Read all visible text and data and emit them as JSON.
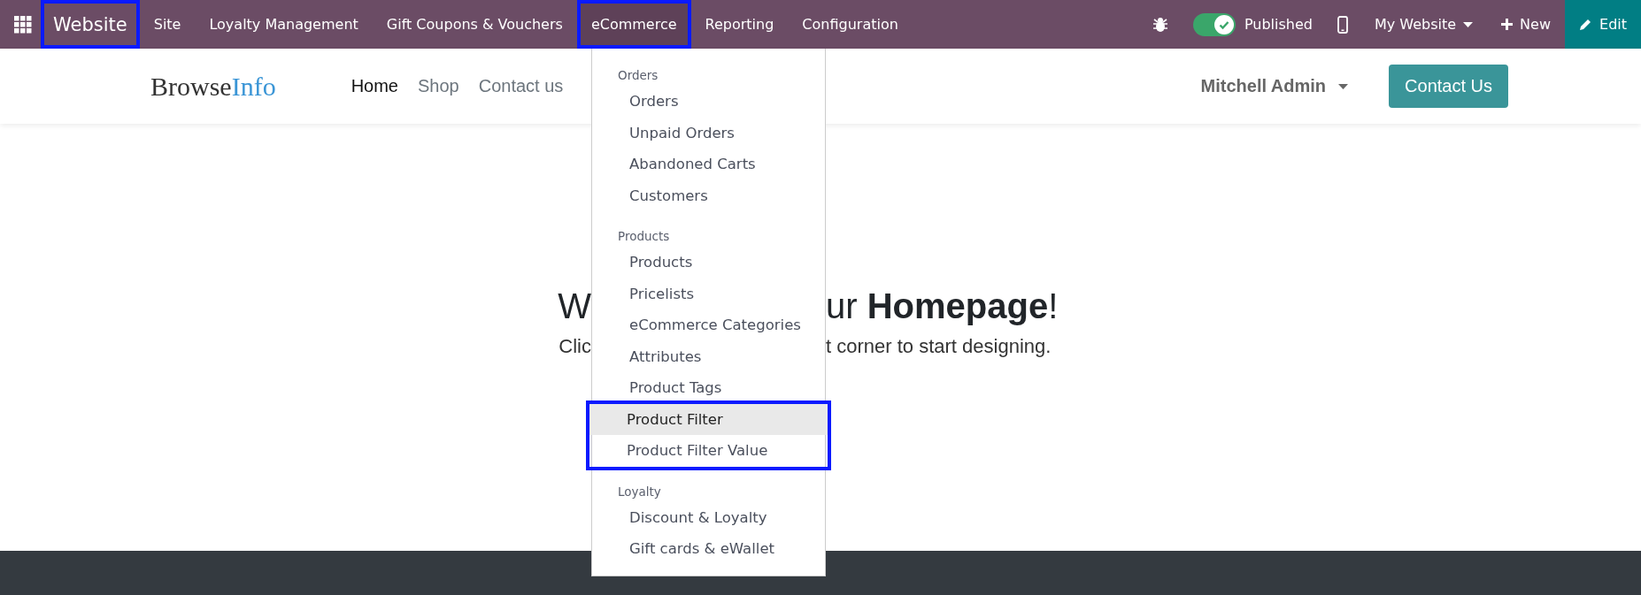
{
  "top_bar": {
    "app_name": {
      "label": "Website",
      "outlined": true
    },
    "menu": [
      {
        "label": "Site",
        "selected": false,
        "outlined": false
      },
      {
        "label": "Loyalty Management",
        "selected": false,
        "outlined": false
      },
      {
        "label": "Gift Coupons & Vouchers",
        "selected": false,
        "outlined": false
      },
      {
        "label": "eCommerce",
        "selected": true,
        "outlined": true
      },
      {
        "label": "Reporting",
        "selected": false,
        "outlined": false
      },
      {
        "label": "Configuration",
        "selected": false,
        "outlined": false
      }
    ],
    "published": {
      "label": "Published",
      "on": true
    },
    "website_switcher": "My Website",
    "new_button": "New",
    "edit_button": "Edit"
  },
  "site_header": {
    "logo": {
      "part_1": "Browse",
      "part_2": "Info"
    },
    "nav": [
      {
        "label": "Home",
        "selected": true
      },
      {
        "label": "Shop",
        "selected": false
      },
      {
        "label": "Contact us",
        "selected": false
      }
    ],
    "user": "Mitchell Admin",
    "cta": "Contact Us"
  },
  "dropdown": {
    "sections": [
      {
        "title": "Orders",
        "items": [
          {
            "label": "Orders",
            "selected": false,
            "outlined": false
          },
          {
            "label": "Unpaid Orders",
            "selected": false,
            "outlined": false
          },
          {
            "label": "Abandoned Carts",
            "selected": false,
            "outlined": false
          },
          {
            "label": "Customers",
            "selected": false,
            "outlined": false
          }
        ]
      },
      {
        "title": "Products",
        "items": [
          {
            "label": "Products",
            "selected": false,
            "outlined": false
          },
          {
            "label": "Pricelists",
            "selected": false,
            "outlined": false
          },
          {
            "label": "eCommerce Categories",
            "selected": false,
            "outlined": false
          },
          {
            "label": "Attributes",
            "selected": false,
            "outlined": false
          },
          {
            "label": "Product Tags",
            "selected": false,
            "outlined": false
          },
          {
            "label": "Product Filter",
            "selected": true,
            "outlined": true
          },
          {
            "label": "Product Filter Value",
            "selected": false,
            "outlined": true
          }
        ]
      },
      {
        "title": "Loyalty",
        "items": [
          {
            "label": "Discount & Loyalty",
            "selected": false,
            "outlined": false
          },
          {
            "label": "Gift cards & eWallet",
            "selected": false,
            "outlined": false
          }
        ]
      }
    ]
  },
  "hero": {
    "headline_left": "W",
    "headline_right": "ur **Homepage**!",
    "subtitle_left": "Clic",
    "subtitle_right": "t corner to start designing."
  }
}
